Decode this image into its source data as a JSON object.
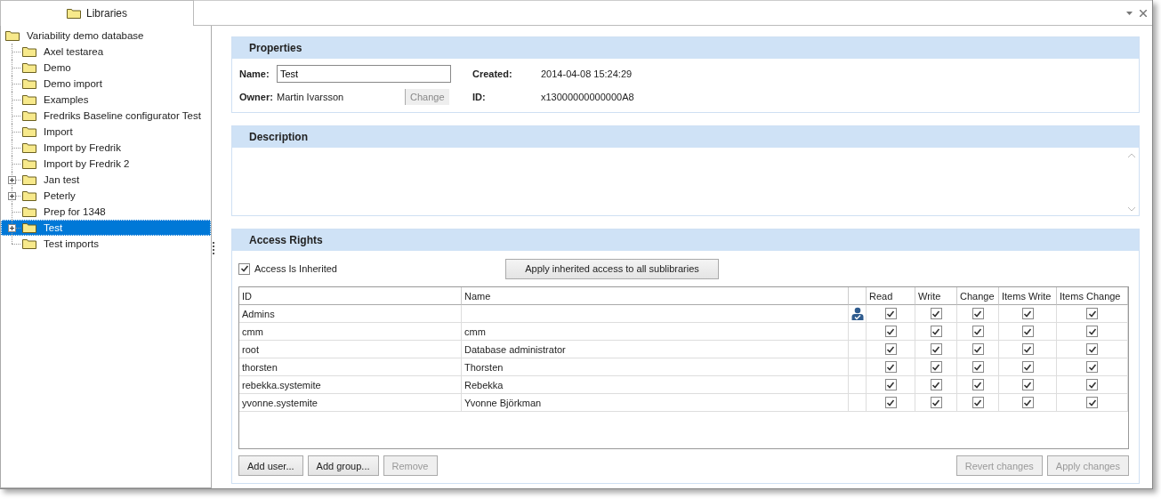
{
  "tab": {
    "label": "Libraries",
    "selected": true
  },
  "tree": {
    "label": "Variability demo database",
    "children": [
      {
        "label": "Axel testarea",
        "selected": false,
        "expander": false
      },
      {
        "label": "Demo",
        "selected": false,
        "expander": false
      },
      {
        "label": "Demo import",
        "selected": false,
        "expander": false
      },
      {
        "label": "Examples",
        "selected": false,
        "expander": false
      },
      {
        "label": "Fredriks Baseline configurator Test",
        "selected": false,
        "expander": false
      },
      {
        "label": "Import",
        "selected": false,
        "expander": false
      },
      {
        "label": "Import by Fredrik",
        "selected": false,
        "expander": false
      },
      {
        "label": "Import by Fredrik 2",
        "selected": false,
        "expander": false
      },
      {
        "label": "Jan test",
        "selected": false,
        "expander": true
      },
      {
        "label": "Peterly",
        "selected": false,
        "expander": true
      },
      {
        "label": "Prep for 1348",
        "selected": false,
        "expander": false
      },
      {
        "label": "Test",
        "selected": true,
        "expander": true
      },
      {
        "label": "Test imports",
        "selected": false,
        "expander": false
      }
    ]
  },
  "properties": {
    "title": "Properties",
    "name_label": "Name:",
    "name_value": "Test",
    "owner_label": "Owner:",
    "owner_value": "Martin Ivarsson",
    "change_button": {
      "label": "Change",
      "disabled": true
    },
    "created_label": "Created:",
    "created_value": "2014-04-08 15:24:29",
    "id_label": "ID:",
    "id_value": "x13000000000000A8"
  },
  "description": {
    "title": "Description"
  },
  "access": {
    "title": "Access Rights",
    "inherited": {
      "label": "Access Is Inherited",
      "checked": true
    },
    "apply_inherited_button": "Apply inherited access to all sublibraries",
    "columns": [
      "ID",
      "Name",
      "Read",
      "Write",
      "Change",
      "Items Write",
      "Items Change"
    ],
    "rows": [
      {
        "id": "Admins",
        "name": "",
        "group": true,
        "rights": [
          true,
          true,
          true,
          true,
          true
        ]
      },
      {
        "id": "cmm",
        "name": "cmm",
        "group": false,
        "rights": [
          true,
          true,
          true,
          true,
          true
        ]
      },
      {
        "id": "root",
        "name": "Database administrator",
        "group": false,
        "rights": [
          true,
          true,
          true,
          true,
          true
        ]
      },
      {
        "id": "thorsten",
        "name": "Thorsten",
        "group": false,
        "rights": [
          true,
          true,
          true,
          true,
          true
        ]
      },
      {
        "id": "rebekka.systemite",
        "name": "Rebekka",
        "group": false,
        "rights": [
          true,
          true,
          true,
          true,
          true
        ]
      },
      {
        "id": "yvonne.systemite",
        "name": "Yvonne Björkman",
        "group": false,
        "rights": [
          true,
          true,
          true,
          true,
          true
        ]
      }
    ],
    "left_buttons": [
      {
        "label": "Add user...",
        "disabled": false
      },
      {
        "label": "Add group...",
        "disabled": false
      },
      {
        "label": "Remove",
        "disabled": true
      }
    ],
    "right_buttons": [
      {
        "label": "Revert changes",
        "disabled": true
      },
      {
        "label": "Apply changes",
        "disabled": true
      }
    ]
  }
}
